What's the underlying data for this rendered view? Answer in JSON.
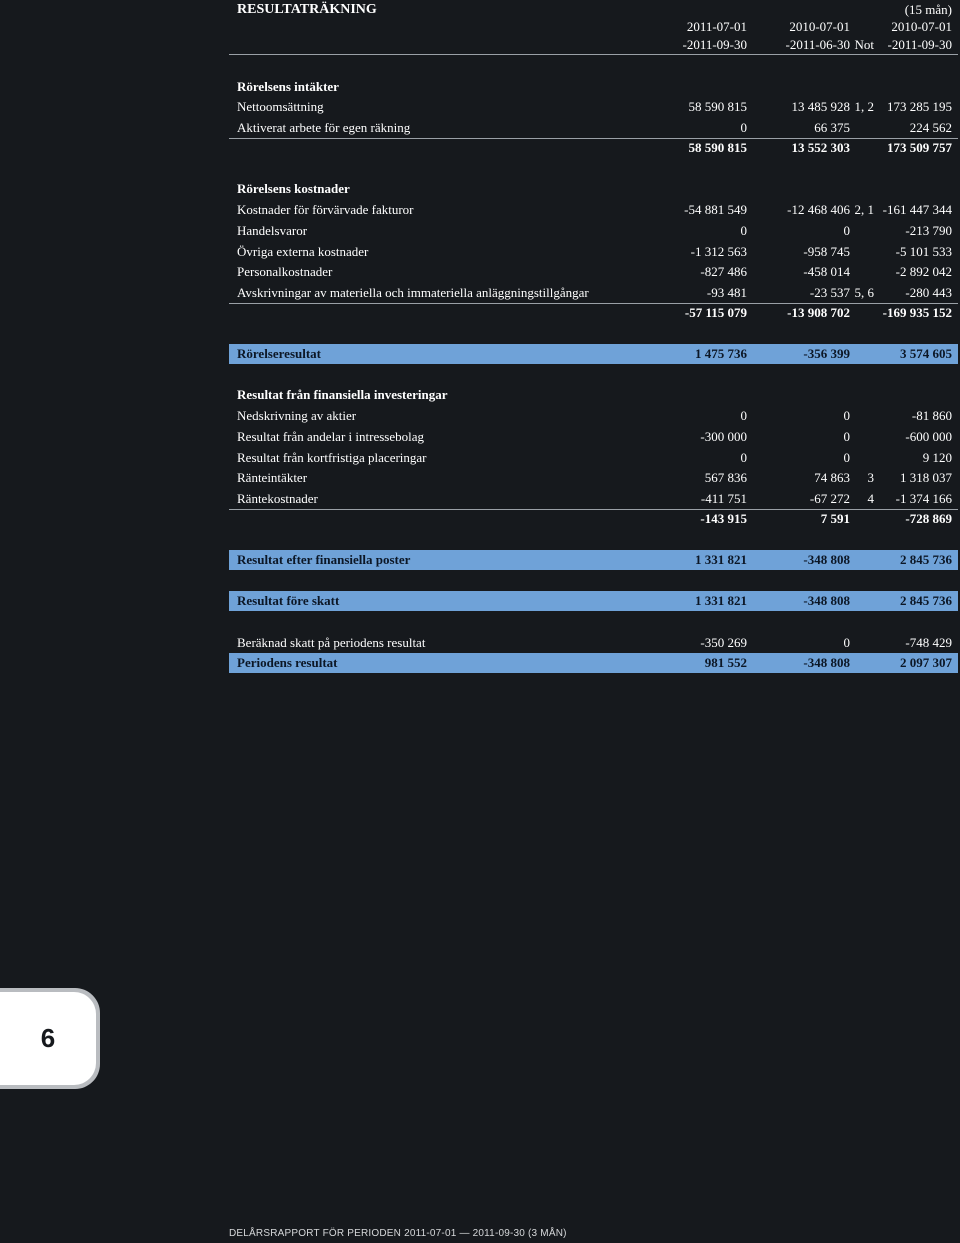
{
  "header": {
    "title": "RESULTATRÄKNING",
    "period_note": "(15 mån)",
    "col_not": "Not",
    "col1_line1": "2011-07-01",
    "col1_line2": "-2011-09-30",
    "col2_line1": "2010-07-01",
    "col2_line2": "-2011-06-30",
    "col3_line1": "2010-07-01",
    "col3_line2": "-2011-09-30"
  },
  "rows": [
    {
      "label": "Rörelsens intäkter",
      "not": "",
      "v1": "",
      "v2": "",
      "v3": ""
    },
    {
      "label": "Nettoomsättning",
      "not": "1, 2",
      "v1": "58 590 815",
      "v2": "13 485 928",
      "v3": "173 285 195"
    },
    {
      "label": "Aktiverat arbete för egen räkning",
      "not": "",
      "v1": "0",
      "v2": "66 375",
      "v3": "224 562"
    },
    {
      "label": "",
      "not": "",
      "v1": "58 590 815",
      "v2": "13 552 303",
      "v3": "173 509 757"
    },
    {
      "label": "Rörelsens kostnader",
      "not": "",
      "v1": "",
      "v2": "",
      "v3": ""
    },
    {
      "label": "Kostnader för förvärvade fakturor",
      "not": "2, 1",
      "v1": "-54 881 549",
      "v2": "-12 468 406",
      "v3": "-161 447 344"
    },
    {
      "label": "Handelsvaror",
      "not": "",
      "v1": "0",
      "v2": "0",
      "v3": "-213 790"
    },
    {
      "label": "Övriga externa kostnader",
      "not": "",
      "v1": "-1 312 563",
      "v2": "-958 745",
      "v3": "-5 101 533"
    },
    {
      "label": "Personalkostnader",
      "not": "",
      "v1": "-827 486",
      "v2": "-458 014",
      "v3": "-2 892 042"
    },
    {
      "label": "Avskrivningar av materiella och immateriella anläggningstillgångar",
      "not": "5, 6",
      "v1": "-93 481",
      "v2": "-23 537",
      "v3": "-280 443"
    },
    {
      "label": "",
      "not": "",
      "v1": "-57 115 079",
      "v2": "-13 908 702",
      "v3": "-169 935 152"
    },
    {
      "label": "Rörelseresultat",
      "not": "",
      "v1": "1 475 736",
      "v2": "-356 399",
      "v3": "3 574 605"
    },
    {
      "label": "Resultat från finansiella investeringar",
      "not": "",
      "v1": "",
      "v2": "",
      "v3": ""
    },
    {
      "label": "Nedskrivning av aktier",
      "not": "",
      "v1": "0",
      "v2": "0",
      "v3": "-81 860"
    },
    {
      "label": "Resultat från andelar i intressebolag",
      "not": "",
      "v1": "-300 000",
      "v2": "0",
      "v3": "-600 000"
    },
    {
      "label": "Resultat från kortfristiga placeringar",
      "not": "",
      "v1": "0",
      "v2": "0",
      "v3": "9 120"
    },
    {
      "label": "Ränteintäkter",
      "not": "3",
      "v1": "567 836",
      "v2": "74 863",
      "v3": "1 318 037"
    },
    {
      "label": "Räntekostnader",
      "not": "4",
      "v1": "-411 751",
      "v2": "-67 272",
      "v3": "-1 374 166"
    },
    {
      "label": "",
      "not": "",
      "v1": "-143 915",
      "v2": "7 591",
      "v3": "-728 869"
    },
    {
      "label": "Resultat efter finansiella poster",
      "not": "",
      "v1": "1 331 821",
      "v2": "-348 808",
      "v3": "2 845 736"
    },
    {
      "label": "Resultat före skatt",
      "not": "",
      "v1": "1 331 821",
      "v2": "-348 808",
      "v3": "2 845 736"
    },
    {
      "label": "Beräknad skatt på periodens resultat",
      "not": "",
      "v1": "-350 269",
      "v2": "0",
      "v3": "-748 429"
    },
    {
      "label": "Periodens resultat",
      "not": "",
      "v1": "981 552",
      "v2": "-348 808",
      "v3": "2 097 307"
    }
  ],
  "page_tab": {
    "number": "6"
  },
  "footer": {
    "text": "DELÅRSRAPPORT FÖR PERIODEN 2011-07-01 — 2011-09-30 (3 MÅN)"
  }
}
